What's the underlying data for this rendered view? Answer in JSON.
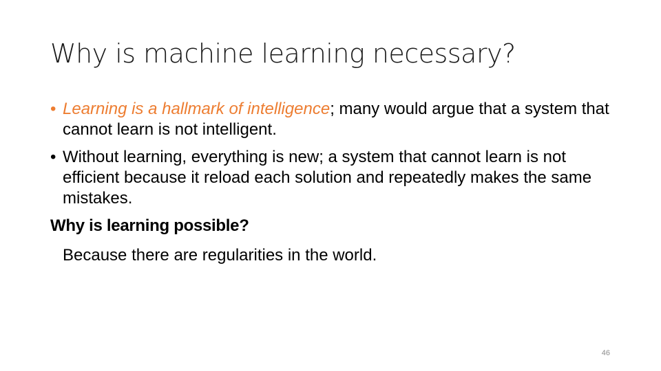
{
  "slide": {
    "title": "Why is machine learning necessary?",
    "bullets": [
      {
        "marker": "•",
        "highlight": "Learning is a hallmark of intelligence",
        "text": "; many would argue that a system that cannot learn is not intelligent."
      },
      {
        "marker": "•",
        "text": "Without learning, everything is new; a system that cannot learn is not efficient because it reload each solution and repeatedly makes the same mistakes."
      }
    ],
    "subheading": "Why is learning possible?",
    "subtext": "Because there are regularities in the world.",
    "page_number": "46"
  },
  "colors": {
    "accent": "#ED7D31",
    "text": "#000000",
    "page_number": "#8c8c8c"
  }
}
